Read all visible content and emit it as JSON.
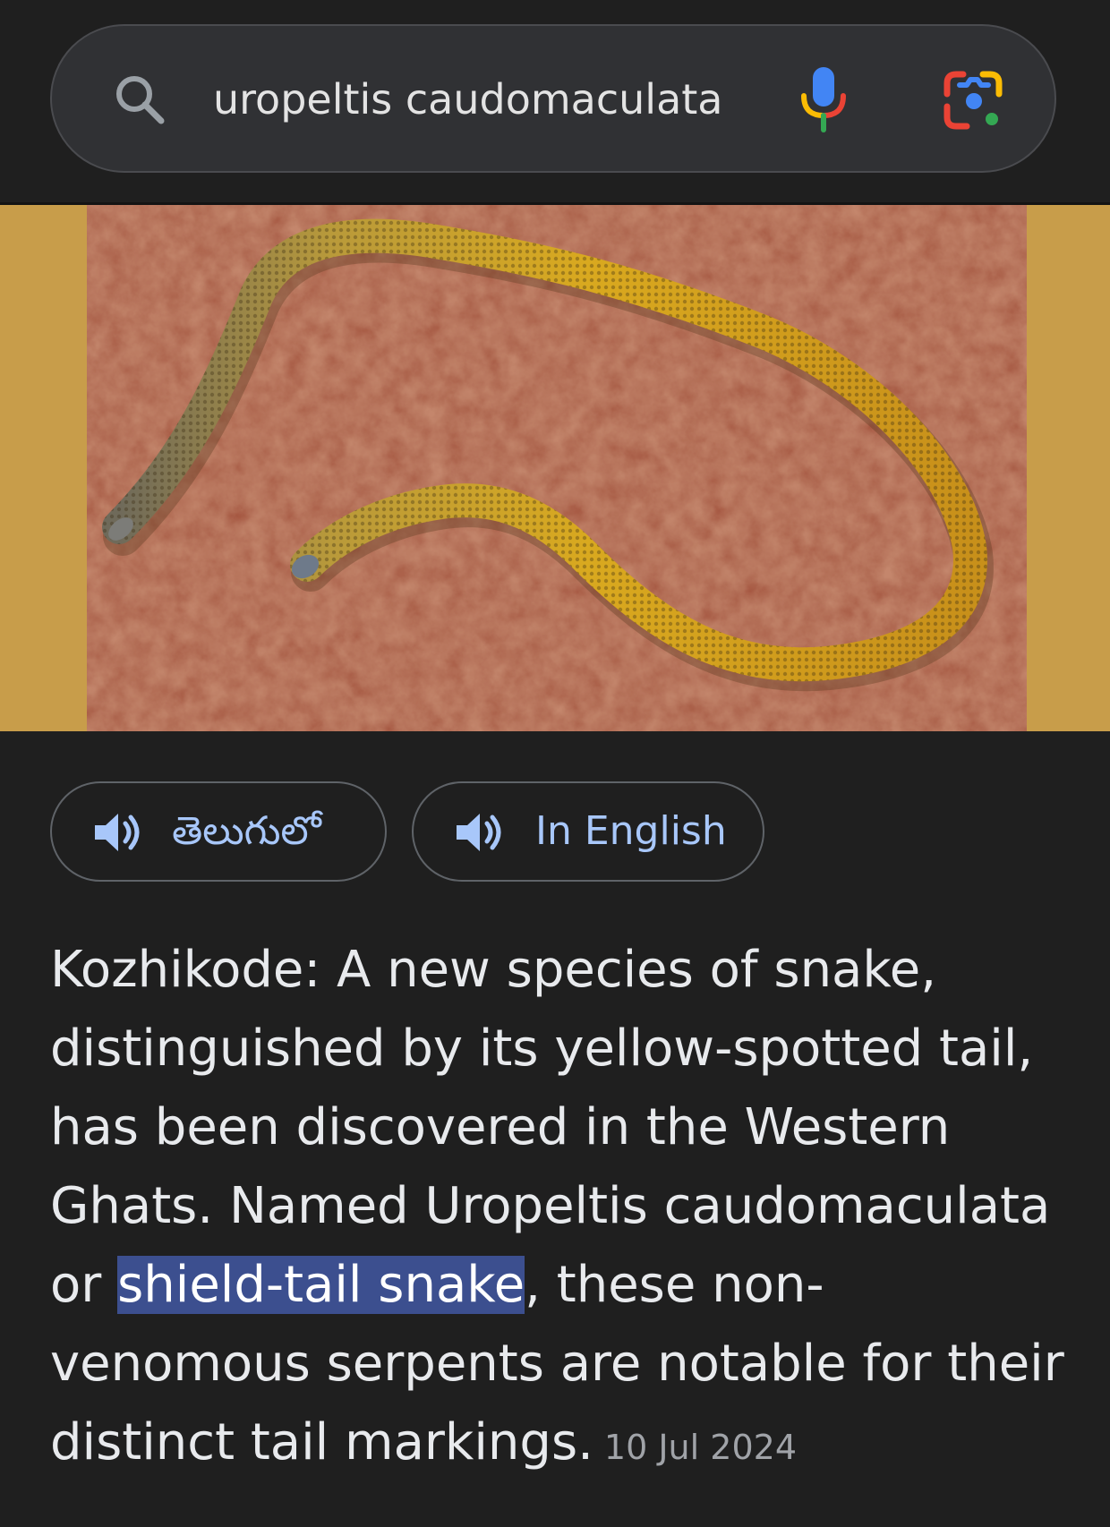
{
  "search": {
    "query": "uropeltis caudomaculata",
    "icons": [
      "search-icon",
      "mic-icon",
      "lens-icon"
    ]
  },
  "hero": {
    "image": "snake-photo"
  },
  "language_buttons": [
    {
      "label": "తెలుగులో",
      "icon": "speaker-icon"
    },
    {
      "label": "In English",
      "icon": "speaker-icon"
    }
  ],
  "article": {
    "text_before": "Kozhikode: A new species of snake, distinguished by its yellow-spotted tail, has been discovered in the Western Ghats. Named Uropeltis caudomaculata or ",
    "highlight": "shield-tail snake",
    "text_after": ", these non-venomous serpents are notable for their distinct tail markings.",
    "date": "10 Jul 2024"
  },
  "colors": {
    "background": "#1f1f1f",
    "search_box": "#303134",
    "link_blue": "#a8c7fa",
    "highlight": "#3c4f8f",
    "hero_border": "#c89d4a"
  }
}
